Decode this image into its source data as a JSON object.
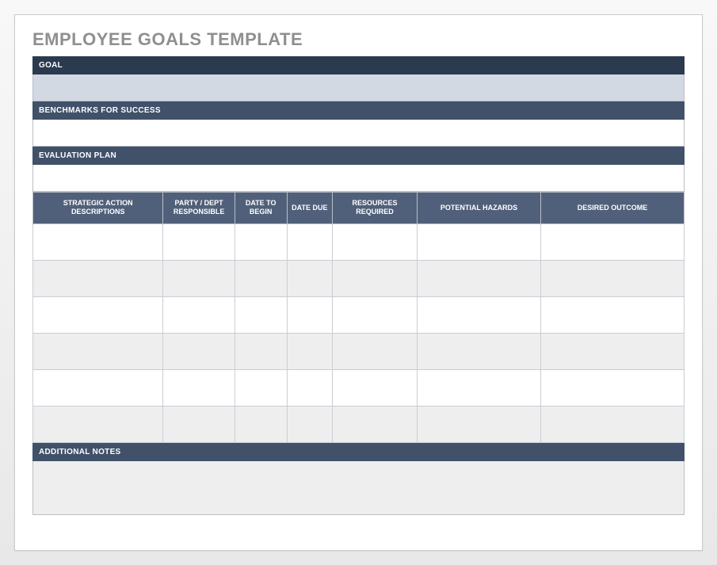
{
  "title": "EMPLOYEE GOALS TEMPLATE",
  "sections": {
    "goal": {
      "label": "GOAL",
      "value": ""
    },
    "benchmarks": {
      "label": "BENCHMARKS FOR SUCCESS",
      "value": ""
    },
    "evaluation": {
      "label": "EVALUATION PLAN",
      "value": ""
    },
    "notes": {
      "label": "ADDITIONAL NOTES",
      "value": ""
    }
  },
  "table": {
    "headers": [
      "STRATEGIC ACTION DESCRIPTIONS",
      "PARTY / DEPT RESPONSIBLE",
      "DATE TO BEGIN",
      "DATE DUE",
      "RESOURCES REQUIRED",
      "POTENTIAL HAZARDS",
      "DESIRED OUTCOME"
    ],
    "rows": [
      [
        "",
        "",
        "",
        "",
        "",
        "",
        ""
      ],
      [
        "",
        "",
        "",
        "",
        "",
        "",
        ""
      ],
      [
        "",
        "",
        "",
        "",
        "",
        "",
        ""
      ],
      [
        "",
        "",
        "",
        "",
        "",
        "",
        ""
      ],
      [
        "",
        "",
        "",
        "",
        "",
        "",
        ""
      ],
      [
        "",
        "",
        "",
        "",
        "",
        "",
        ""
      ]
    ]
  }
}
